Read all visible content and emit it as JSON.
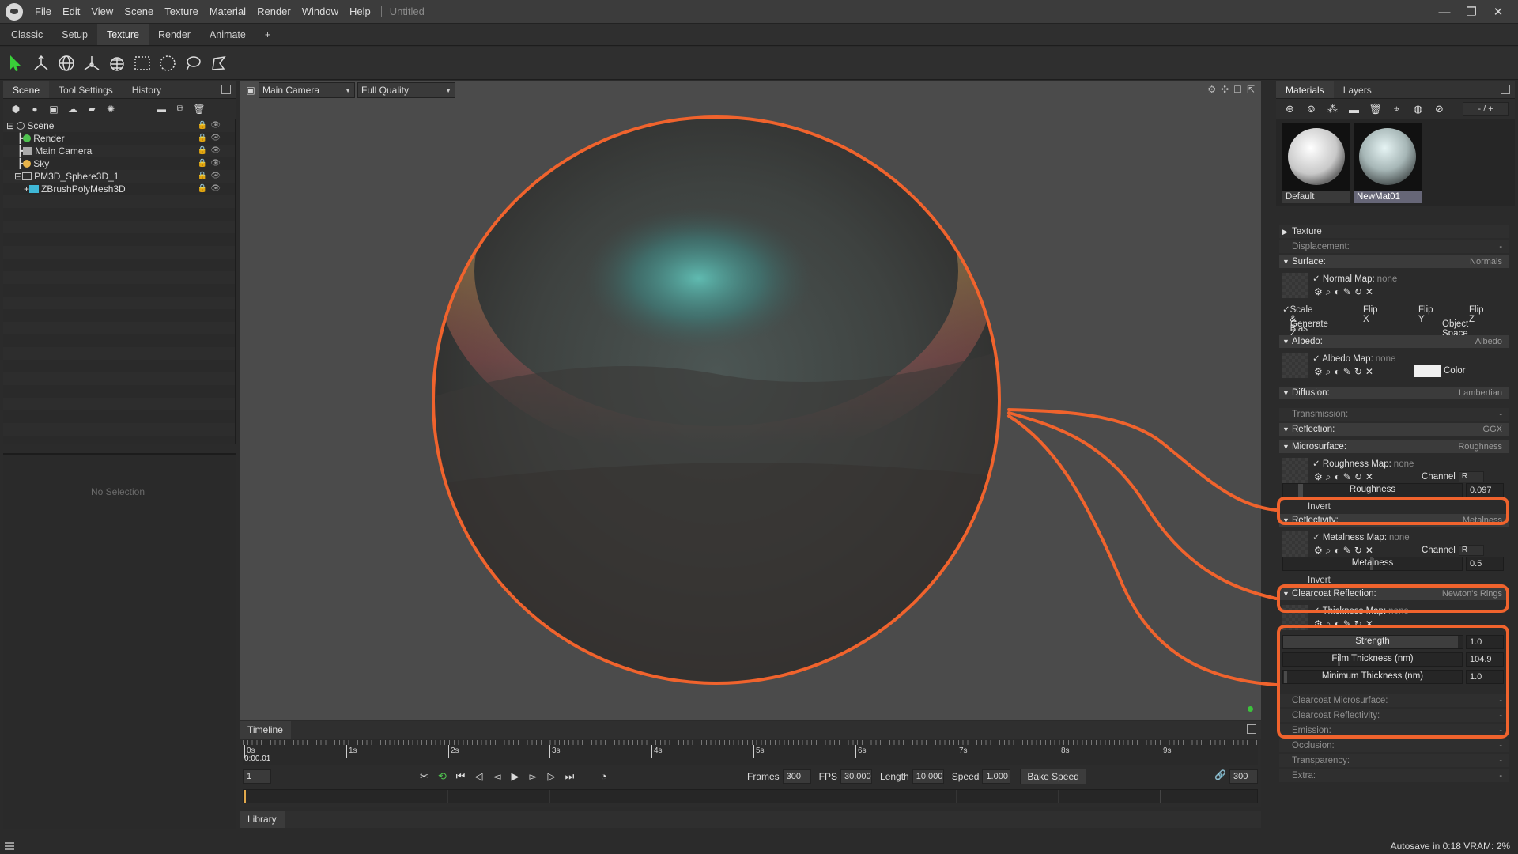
{
  "app": {
    "menu": [
      "File",
      "Edit",
      "View",
      "Scene",
      "Texture",
      "Material",
      "Render",
      "Window",
      "Help"
    ],
    "title": "Untitled"
  },
  "workspace_tabs": [
    "Classic",
    "Setup",
    "Texture",
    "Render",
    "Animate",
    "+"
  ],
  "tools": [
    "select-arrow-icon",
    "transform-gizmo-icon",
    "globe-icon",
    "axes-icon",
    "sphere-wire-icon",
    "rect-select-icon",
    "circle-select-icon",
    "lasso-icon",
    "polygon-lasso-icon"
  ],
  "left_panel": {
    "tabs": [
      "Scene",
      "Tool Settings",
      "History"
    ],
    "tree": [
      "Scene",
      "Render",
      "Main Camera",
      "Sky",
      "PM3D_Sphere3D_1",
      "ZBrushPolyMesh3D"
    ],
    "no_selection": "No Selection"
  },
  "viewport": {
    "camera": "Main Camera",
    "quality": "Full Quality"
  },
  "timeline": {
    "tab": "Timeline",
    "ruler": [
      "0s",
      "1s",
      "2s",
      "3s",
      "4s",
      "5s",
      "6s",
      "7s",
      "8s",
      "9s"
    ],
    "current_time": "0:00.01",
    "frame_field": "1",
    "frames_label": "Frames",
    "frames": "300",
    "fps_label": "FPS",
    "fps": "30.000",
    "length_label": "Length",
    "length": "10.000",
    "speed_label": "Speed",
    "speed": "1.000",
    "bake_speed": "Bake Speed",
    "end_frame": "300"
  },
  "library": "Library",
  "status": "Autosave in 0:18  VRAM: 2%",
  "right_panel": {
    "tabs": [
      "Materials",
      "Layers"
    ],
    "counter": "- / +",
    "materials": [
      "Default",
      "NewMat01"
    ],
    "sections": {
      "texture": "Texture",
      "displacement": "Displacement:",
      "displacement_val": "-",
      "surface": "Surface:",
      "surface_val": "Normals",
      "normal_map": "Normal Map:",
      "none": "none",
      "scale_bias": "Scale & Bias",
      "flip_x": "Flip X",
      "flip_y": "Flip Y",
      "flip_z": "Flip Z",
      "generate_z": "Generate Z",
      "object_space": "Object Space",
      "albedo": "Albedo:",
      "albedo_val": "Albedo",
      "albedo_map": "Albedo Map:",
      "color": "Color",
      "diffusion": "Diffusion:",
      "diffusion_val": "Lambertian",
      "transmission": "Transmission:",
      "transmission_val": "-",
      "reflection": "Reflection:",
      "reflection_val": "GGX",
      "microsurface": "Microsurface:",
      "microsurface_val": "Roughness",
      "roughness_map": "Roughness Map:",
      "channel": "Channel",
      "channel_val": "R",
      "roughness": "Roughness",
      "roughness_val": "0.097",
      "invert": "Invert",
      "reflectivity": "Reflectivity:",
      "reflectivity_val": "Metalness",
      "metalness_map": "Metalness Map:",
      "metalness": "Metalness",
      "metalness_val": "0.5",
      "clearcoat": "Clearcoat Reflection:",
      "clearcoat_val": "Newton's Rings",
      "thickness_map": "Thickness Map:",
      "strength": "Strength",
      "strength_val": "1.0",
      "film_thickness": "Film Thickness (nm)",
      "film_thickness_val": "104.9",
      "min_thickness": "Minimum Thickness (nm)",
      "min_thickness_val": "1.0",
      "cc_micro": "Clearcoat Microsurface:",
      "cc_reflectivity": "Clearcoat Reflectivity:",
      "emission": "Emission:",
      "occlusion": "Occlusion:",
      "transparency": "Transparency:",
      "extra": "Extra:",
      "dash": "-"
    }
  },
  "colors": {
    "annotation": "#f0632d",
    "accent_green": "#3cc23c"
  }
}
